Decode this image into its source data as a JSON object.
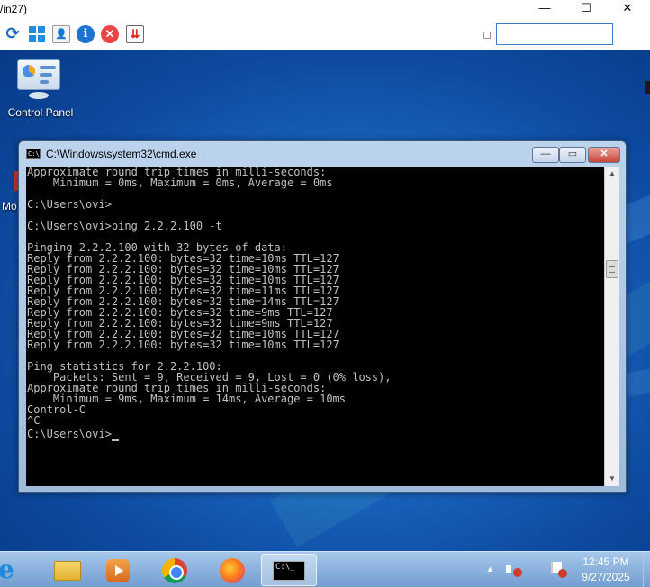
{
  "host_window": {
    "title_fragment": "/in27)",
    "controls": {
      "minimize": "—",
      "maximize": "☐",
      "close": "✕"
    }
  },
  "host_toolbar": {
    "refresh_glyph": "⟳",
    "user_glyph": "👤",
    "info_glyph": "i",
    "stop_glyph": "✕",
    "export_glyph": "⇊",
    "search_value": ""
  },
  "desktop": {
    "icons": [
      {
        "label": "Control Panel",
        "icon": "control-panel-icon"
      }
    ],
    "partial_label": "Mo"
  },
  "cmd_window": {
    "title": "C:\\Windows\\system32\\cmd.exe",
    "icon_text": "C:\\",
    "controls": {
      "minimize": "—",
      "maximize": "▭",
      "close": "✕"
    },
    "lines": [
      "Approximate round trip times in milli-seconds:",
      "    Minimum = 0ms, Maximum = 0ms, Average = 0ms",
      "",
      "C:\\Users\\ovi>",
      "",
      "C:\\Users\\ovi>ping 2.2.2.100 -t",
      "",
      "Pinging 2.2.2.100 with 32 bytes of data:",
      "Reply from 2.2.2.100: bytes=32 time=10ms TTL=127",
      "Reply from 2.2.2.100: bytes=32 time=10ms TTL=127",
      "Reply from 2.2.2.100: bytes=32 time=10ms TTL=127",
      "Reply from 2.2.2.100: bytes=32 time=11ms TTL=127",
      "Reply from 2.2.2.100: bytes=32 time=14ms TTL=127",
      "Reply from 2.2.2.100: bytes=32 time=9ms TTL=127",
      "Reply from 2.2.2.100: bytes=32 time=9ms TTL=127",
      "Reply from 2.2.2.100: bytes=32 time=10ms TTL=127",
      "Reply from 2.2.2.100: bytes=32 time=10ms TTL=127",
      "",
      "Ping statistics for 2.2.2.100:",
      "    Packets: Sent = 9, Received = 9, Lost = 0 (0% loss),",
      "Approximate round trip times in milli-seconds:",
      "    Minimum = 9ms, Maximum = 14ms, Average = 10ms",
      "Control-C",
      "^C"
    ],
    "prompt": "C:\\Users\\ovi>",
    "scroll_up_glyph": "▲",
    "scroll_down_glyph": "▼"
  },
  "taskbar": {
    "apps": [
      {
        "name": "internet-explorer",
        "glyph": "e"
      },
      {
        "name": "file-explorer"
      },
      {
        "name": "media-player"
      },
      {
        "name": "chrome"
      },
      {
        "name": "firefox"
      },
      {
        "name": "command-prompt",
        "glyph": "C:\\_",
        "active": true
      }
    ],
    "tray": {
      "chevron": "▲",
      "time": "12:45 PM",
      "date": "9/27/2025"
    }
  },
  "colors": {
    "console_bg": "#000000",
    "console_fg": "#c0c0c0",
    "desktop_blue": "#1b69c4",
    "accent": "#3c7fd1"
  }
}
